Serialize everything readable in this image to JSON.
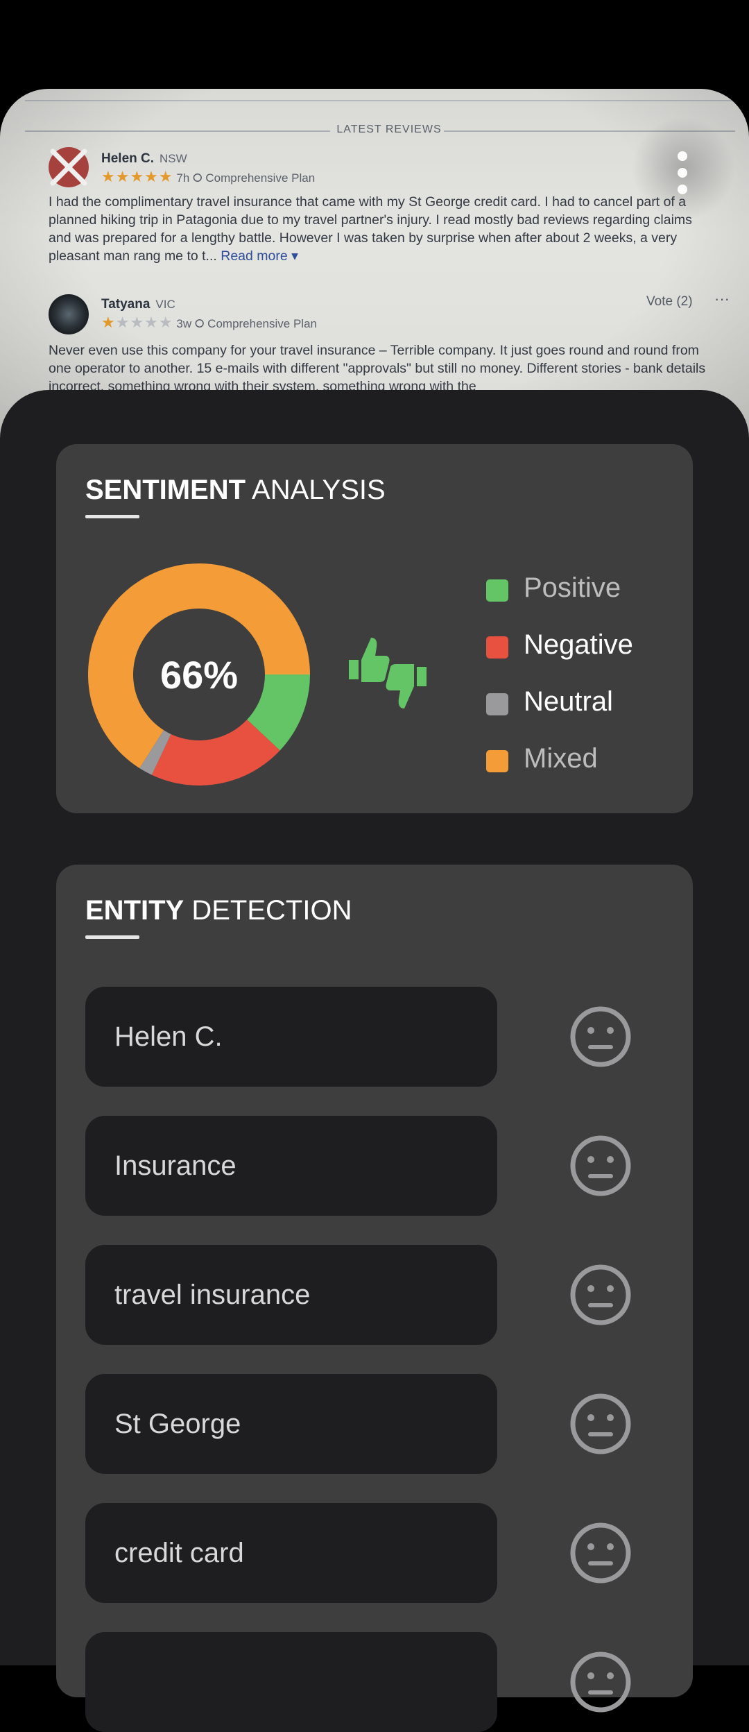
{
  "photo": {
    "header": "LATEST REVIEWS",
    "reviews": [
      {
        "name": "Helen C.",
        "state": "NSW",
        "stars": "★★★★★",
        "time": "7h",
        "plan": "Comprehensive Plan",
        "body": "I had the complimentary travel insurance that came with my St George credit card. I had to cancel part of a planned hiking trip in Patagonia due to my travel partner's injury. I read mostly bad reviews regarding claims and was prepared for a lengthy battle. However I was taken by surprise when after about 2 weeks, a very pleasant man rang me to t...",
        "read_more": "Read more ▾"
      },
      {
        "name": "Tatyana",
        "state": "VIC",
        "stars": "★★★★★",
        "time": "3w",
        "plan": "Comprehensive Plan",
        "vote": "Vote (2)",
        "more": "···",
        "body": "Never even use this company for your travel insurance – Terrible company. It just goes round and round from one operator to another. 15 e-mails with different \"approvals\" but still no money. Different stories - bank details incorrect, something wrong with their system, something wrong with the"
      }
    ]
  },
  "sentiment": {
    "title_bold": "SENTIMENT",
    "title_light": "ANALYSIS",
    "center_label": "66%",
    "legend": [
      {
        "label": "Positive",
        "color": "#64c566",
        "text_color": "#bdbdbd"
      },
      {
        "label": "Negative",
        "color": "#e85140",
        "text_color": "#ffffff"
      },
      {
        "label": "Neutral",
        "color": "#9a9a9c",
        "text_color": "#ffffff"
      },
      {
        "label": "Mixed",
        "color": "#f39c38",
        "text_color": "#bdbdbd"
      }
    ]
  },
  "chart_data": {
    "type": "pie",
    "style": "donut",
    "center_label": "66%",
    "categories": [
      "Mixed",
      "Positive",
      "Negative",
      "Neutral"
    ],
    "values": [
      66,
      12,
      20,
      2
    ],
    "colors": [
      "#f39c38",
      "#64c566",
      "#e85140",
      "#9a9a9c"
    ]
  },
  "entities": {
    "title_bold": "ENTITY",
    "title_light": "DETECTION",
    "items": [
      "Helen C.",
      "Insurance",
      "travel insurance",
      "St George",
      "credit card",
      ""
    ],
    "icon": "neutral-face-icon"
  }
}
